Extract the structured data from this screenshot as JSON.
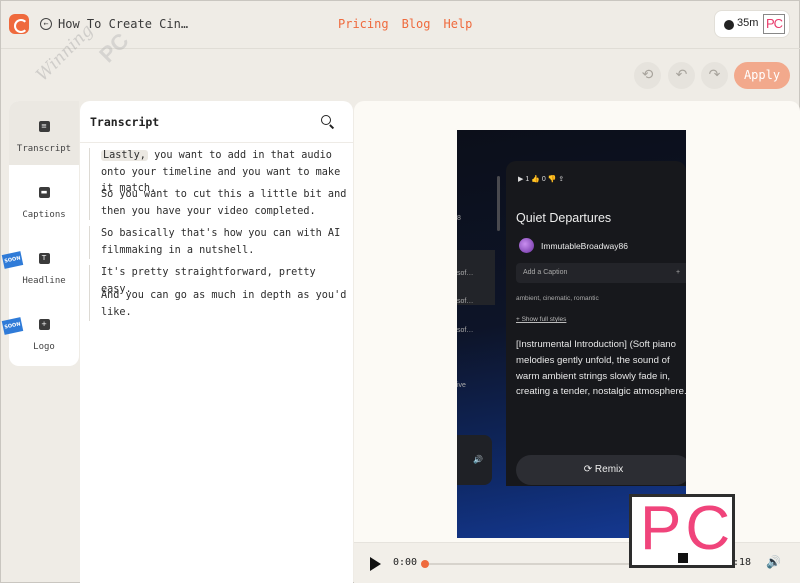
{
  "header": {
    "page_title": "How To Create Cin…",
    "nav": [
      "Pricing",
      "Blog",
      "Help"
    ],
    "credits": "35m",
    "brand_badge": "PC"
  },
  "toolbar": {
    "refresh_icon": "⟲",
    "undo_icon": "↶",
    "redo_icon": "↷",
    "apply_label": "Apply"
  },
  "sidebar": {
    "items": [
      {
        "label": "Transcript",
        "icon": "document-icon",
        "active": true
      },
      {
        "label": "Captions",
        "icon": "caption-icon"
      },
      {
        "label": "Headline",
        "icon": "text-icon",
        "glyph": "T",
        "badge": "SOON"
      },
      {
        "label": "Logo",
        "icon": "plus-icon",
        "glyph": "+",
        "badge": "SOON"
      }
    ]
  },
  "transcript": {
    "title": "Transcript",
    "segments": [
      {
        "highlight": "Lastly,",
        "text": " you want to add in that audio onto your timeline and you want to make it match."
      },
      {
        "text": "So you want to cut this a little bit and then you have your video completed."
      },
      {
        "text": "So basically that's how you can with AI filmmaking in a nutshell."
      },
      {
        "text": "It's pretty straightforward, pretty easy."
      },
      {
        "text": "And you can go as much in depth as you'd like."
      }
    ]
  },
  "video": {
    "stats": "▶ 1    👍 0    👎      ⇪",
    "side_labels": [
      "8",
      "sof…",
      "sof…",
      "sof…",
      "ive"
    ],
    "song_title": "Quiet Departures",
    "username": "ImmutableBroadway86",
    "caption_placeholder": "Add a Caption",
    "caption_plus": "+",
    "tags": "ambient, cinematic, romantic",
    "styles_link": "+ Show full styles",
    "lyrics": "[Instrumental Introduction] (Soft piano melodies gently unfold, the sound of warm ambient strings slowly fade in, creating a tender, nostalgic atmosphere.)",
    "remix_label": "⟳  Remix",
    "volume_glyph": "🔊"
  },
  "player": {
    "current_time": "0:00",
    "end_time": "0:18",
    "progress": 0.0,
    "volume_glyph": "🔊"
  },
  "watermark": {
    "script_text": "Winning",
    "small_text": "PC",
    "logo_text": "PC"
  }
}
